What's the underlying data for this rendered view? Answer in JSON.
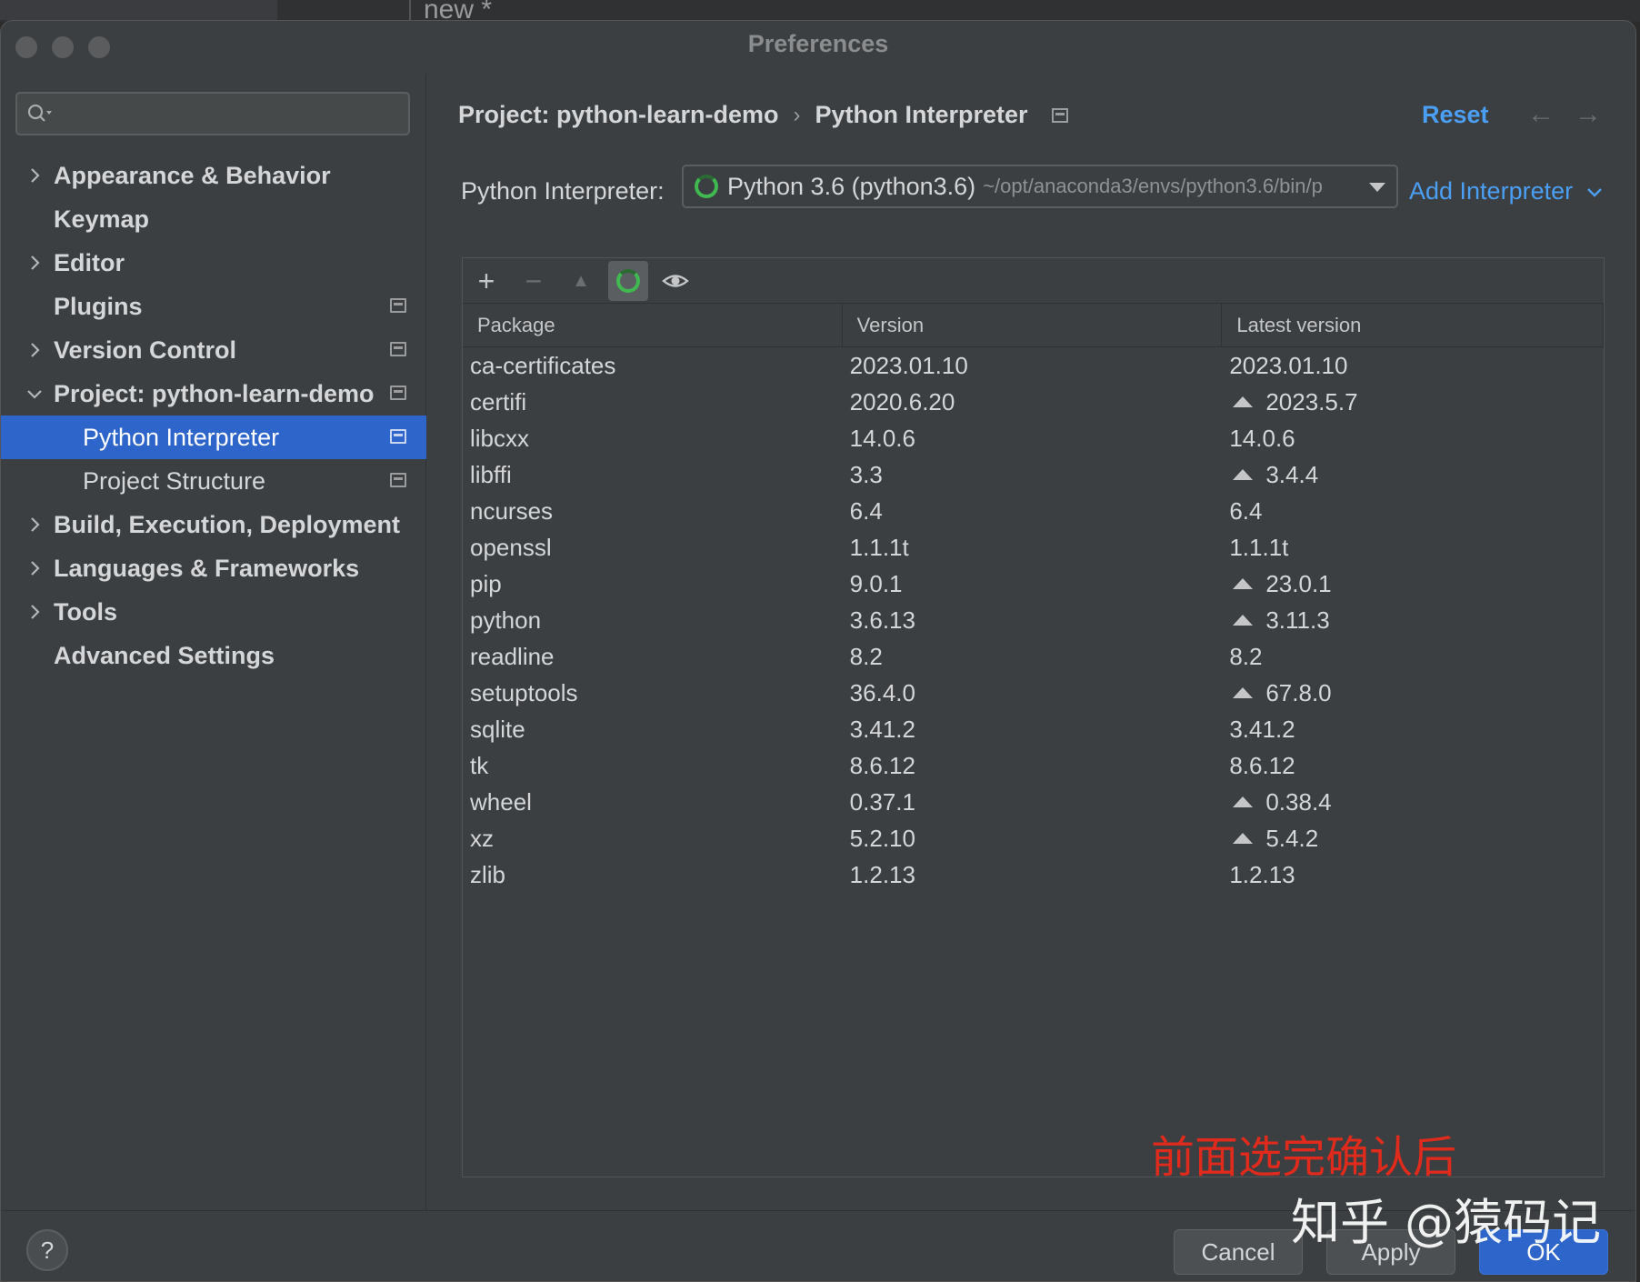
{
  "background_editor_tab": "new *",
  "window": {
    "title": "Preferences"
  },
  "sidebar": {
    "search_placeholder": "",
    "items": [
      {
        "label": "Appearance & Behavior"
      },
      {
        "label": "Keymap"
      },
      {
        "label": "Editor"
      },
      {
        "label": "Plugins"
      },
      {
        "label": "Version Control"
      },
      {
        "label": "Project: python-learn-demo"
      },
      {
        "label": "Python Interpreter"
      },
      {
        "label": "Project Structure"
      },
      {
        "label": "Build, Execution, Deployment"
      },
      {
        "label": "Languages & Frameworks"
      },
      {
        "label": "Tools"
      },
      {
        "label": "Advanced Settings"
      }
    ]
  },
  "header": {
    "breadcrumb_project": "Project: python-learn-demo",
    "breadcrumb_sep": "›",
    "breadcrumb_page": "Python Interpreter",
    "reset": "Reset",
    "back": "←",
    "forward": "→"
  },
  "interpreter": {
    "label": "Python Interpreter:",
    "name": "Python 3.6 (python3.6)",
    "path": "~/opt/anaconda3/envs/python3.6/bin/p",
    "add": "Add Interpreter"
  },
  "toolbar": {
    "add": "+",
    "remove": "−",
    "upgrade": "▲"
  },
  "table": {
    "columns": [
      "Package",
      "Version",
      "Latest version"
    ],
    "rows": [
      {
        "package": "ca-certificates",
        "version": "2023.01.10",
        "latest": "2023.01.10",
        "upgrade": false
      },
      {
        "package": "certifi",
        "version": "2020.6.20",
        "latest": "2023.5.7",
        "upgrade": true
      },
      {
        "package": "libcxx",
        "version": "14.0.6",
        "latest": "14.0.6",
        "upgrade": false
      },
      {
        "package": "libffi",
        "version": "3.3",
        "latest": "3.4.4",
        "upgrade": true
      },
      {
        "package": "ncurses",
        "version": "6.4",
        "latest": "6.4",
        "upgrade": false
      },
      {
        "package": "openssl",
        "version": "1.1.1t",
        "latest": "1.1.1t",
        "upgrade": false
      },
      {
        "package": "pip",
        "version": "9.0.1",
        "latest": "23.0.1",
        "upgrade": true
      },
      {
        "package": "python",
        "version": "3.6.13",
        "latest": "3.11.3",
        "upgrade": true
      },
      {
        "package": "readline",
        "version": "8.2",
        "latest": "8.2",
        "upgrade": false
      },
      {
        "package": "setuptools",
        "version": "36.4.0",
        "latest": "67.8.0",
        "upgrade": true
      },
      {
        "package": "sqlite",
        "version": "3.41.2",
        "latest": "3.41.2",
        "upgrade": false
      },
      {
        "package": "tk",
        "version": "8.6.12",
        "latest": "8.6.12",
        "upgrade": false
      },
      {
        "package": "wheel",
        "version": "0.37.1",
        "latest": "0.38.4",
        "upgrade": true
      },
      {
        "package": "xz",
        "version": "5.2.10",
        "latest": "5.4.2",
        "upgrade": true
      },
      {
        "package": "zlib",
        "version": "1.2.13",
        "latest": "1.2.13",
        "upgrade": false
      }
    ]
  },
  "annotation": "前面选完确认后",
  "footer": {
    "help": "?",
    "cancel": "Cancel",
    "apply": "Apply",
    "ok": "OK"
  },
  "watermark": "知乎 @猿码记",
  "colors": {
    "accent": "#2e65ca",
    "link": "#4a9ff5",
    "annotation": "#e02a1c",
    "loading": "#3fb950"
  }
}
